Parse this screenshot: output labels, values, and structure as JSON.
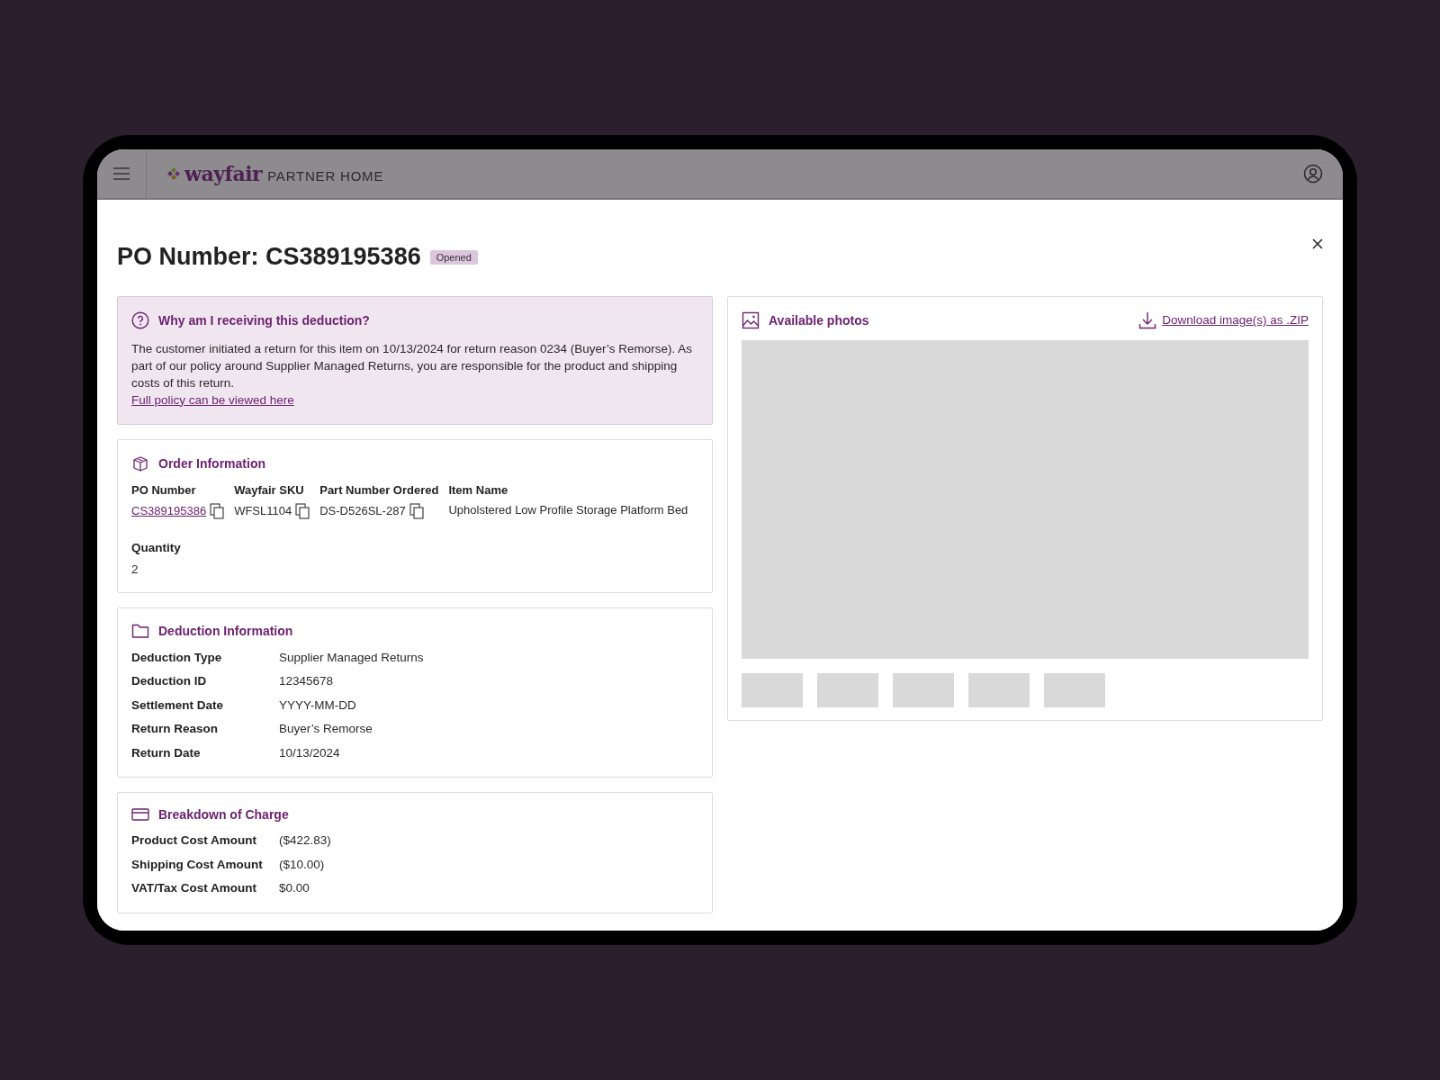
{
  "header": {
    "logo": "wayfair",
    "product": "PARTNER HOME"
  },
  "modal": {
    "title": "PO Number: CS389195386",
    "status": "Opened"
  },
  "notice": {
    "title": "Why am I receiving this deduction?",
    "body": "The customer initiated a return for this item on  10/13/2024 for return reason 0234 (Buyer’s Remorse). As part of our policy around Supplier Managed Returns, you are responsible for the product and shipping costs of this return.",
    "link": "Full policy can be viewed here"
  },
  "order_info": {
    "title": "Order Information",
    "fields": [
      {
        "label": "PO Number",
        "value": "CS389195386",
        "link": true,
        "copy": true
      },
      {
        "label": "Wayfair SKU",
        "value": "WFSL1104",
        "link": false,
        "copy": true
      },
      {
        "label": "Part Number Ordered",
        "value": "DS-D526SL-287",
        "link": false,
        "copy": true
      },
      {
        "label": "Item Name",
        "value": "Upholstered Low Profile Storage Platform Bed",
        "link": false,
        "copy": false
      }
    ],
    "quantity": {
      "label": "Quantity",
      "value": "2"
    }
  },
  "deduction_info": {
    "title": "Deduction Information",
    "rows": [
      {
        "label": "Deduction Type",
        "value": "Supplier Managed Returns"
      },
      {
        "label": "Deduction ID",
        "value": "12345678"
      },
      {
        "label": "Settlement Date",
        "value": "YYYY-MM-DD"
      },
      {
        "label": "Return Reason",
        "value": "Buyer’s Remorse"
      },
      {
        "label": "Return Date",
        "value": "10/13/2024"
      }
    ]
  },
  "breakdown": {
    "title": "Breakdown of Charge",
    "rows": [
      {
        "label": "Product Cost Amount",
        "value": "($422.83)"
      },
      {
        "label": "Shipping Cost Amount",
        "value": "($10.00)"
      },
      {
        "label": "VAT/Tax Cost Amount",
        "value": "$0.00"
      }
    ]
  },
  "photos": {
    "title": "Available photos",
    "download": "Download image(s) as .ZIP"
  }
}
